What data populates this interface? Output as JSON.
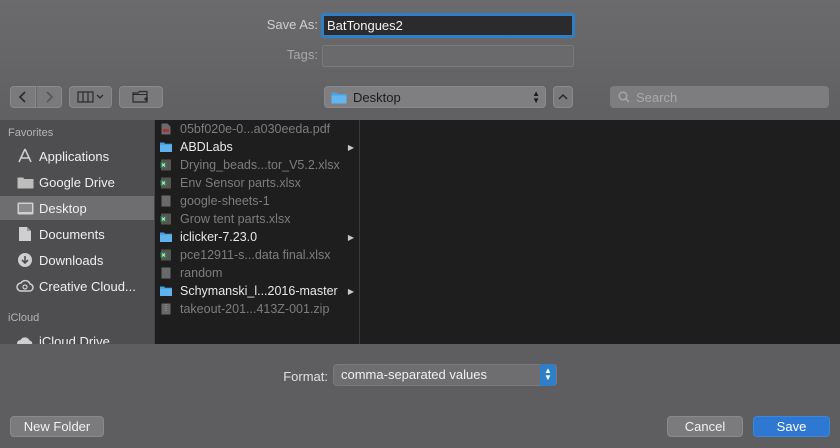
{
  "save_as": {
    "label": "Save As:",
    "value": "BatTongues2"
  },
  "tags": {
    "label": "Tags:",
    "value": ""
  },
  "toolbar": {
    "back_icon": "chevron-left-icon",
    "forward_icon": "chevron-right-icon",
    "view_icon": "column-view-icon",
    "new_folder_icon": "new-folder-icon",
    "location": "Desktop",
    "search_placeholder": "Search"
  },
  "sidebar": {
    "favorites_header": "Favorites",
    "favorites": [
      {
        "label": "Applications",
        "icon": "applications-icon"
      },
      {
        "label": "Google Drive",
        "icon": "folder-icon"
      },
      {
        "label": "Desktop",
        "icon": "desktop-icon",
        "selected": true
      },
      {
        "label": "Documents",
        "icon": "documents-icon"
      },
      {
        "label": "Downloads",
        "icon": "downloads-icon"
      },
      {
        "label": "Creative Cloud...",
        "icon": "creative-cloud-icon"
      }
    ],
    "icloud_header": "iCloud",
    "icloud": [
      {
        "label": "iCloud Drive",
        "icon": "cloud-icon"
      }
    ]
  },
  "files": [
    {
      "name": "05bf020e-0...a030eeda.pdf",
      "type": "pdf",
      "folder": false
    },
    {
      "name": "ABDLabs",
      "type": "folder",
      "folder": true
    },
    {
      "name": "Drying_beads...tor_V5.2.xlsx",
      "type": "xlsx",
      "folder": false
    },
    {
      "name": "Env Sensor parts.xlsx",
      "type": "xlsx",
      "folder": false
    },
    {
      "name": "google-sheets-1",
      "type": "doc",
      "folder": false
    },
    {
      "name": "Grow tent parts.xlsx",
      "type": "xlsx",
      "folder": false
    },
    {
      "name": "iclicker-7.23.0",
      "type": "folder",
      "folder": true
    },
    {
      "name": "pce12911-s...data final.xlsx",
      "type": "xlsx",
      "folder": false
    },
    {
      "name": "random",
      "type": "doc",
      "folder": false
    },
    {
      "name": "Schymanski_l...2016-master",
      "type": "folder",
      "folder": true
    },
    {
      "name": "takeout-201...413Z-001.zip",
      "type": "zip",
      "folder": false
    }
  ],
  "format": {
    "label": "Format:",
    "value": "comma-separated values"
  },
  "buttons": {
    "new_folder": "New Folder",
    "cancel": "Cancel",
    "save": "Save"
  },
  "colors": {
    "accent": "#2e78d1",
    "folder": "#4aa3e0",
    "excel": "#2e7d4a"
  }
}
